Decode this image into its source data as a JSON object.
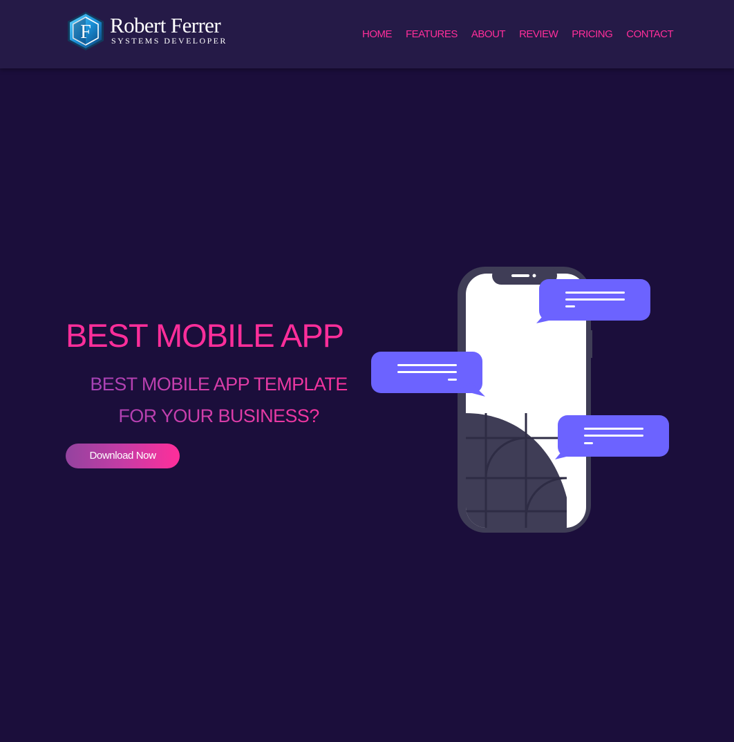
{
  "brand": {
    "name": "Robert Ferrer",
    "tagline": "SYSTEMS DEVELOPER",
    "monogram": "F"
  },
  "nav": {
    "items": [
      {
        "label": "HOME"
      },
      {
        "label": "FEATURES"
      },
      {
        "label": "ABOUT"
      },
      {
        "label": "REVIEW"
      },
      {
        "label": "PRICING"
      },
      {
        "label": "CONTACT"
      }
    ]
  },
  "hero": {
    "title": "BEST MOBILE APP",
    "subtitle_line1": "BEST MOBILE APP TEMPLATE",
    "subtitle_line2": "FOR YOUR BUSINESS?",
    "cta_label": "Download Now"
  },
  "colors": {
    "background": "#1b0e3b",
    "header": "#251a47",
    "accent": "#ff2e9a",
    "bubble": "#6c63ff",
    "phone_frame": "#3f3d56"
  },
  "icons": {
    "logo": "hexagon-monogram-icon",
    "illustration": "phone-chat-illustration"
  }
}
